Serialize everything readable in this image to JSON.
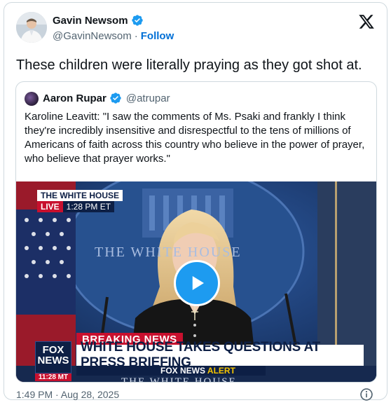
{
  "tweet": {
    "author_name": "Gavin Newsom",
    "author_handle": "@GavinNewsom",
    "separator": "·",
    "follow_label": "Follow",
    "text": "These children were literally praying as they got shot at.",
    "timestamp": "1:49 PM · Aug 28, 2025"
  },
  "quoted_tweet": {
    "author_name": "Aaron Rupar",
    "author_handle": "@atrupar",
    "text": "Karoline Leavitt: \"I saw the comments of Ms. Psaki and frankly I think they're incredibly insensitive and disrespectful to the tens of millions of Americans of faith across this country who believe in the power of prayer, who believe that prayer works.\""
  },
  "video": {
    "top_caption": "THE WHITE HOUSE",
    "live_label": "LIVE",
    "live_time": "1:28 PM ET",
    "seal_text": "THE WHITE HOUSE",
    "breaking_label": "BREAKING NEWS",
    "headline": "WHITE HOUSE TAKES QUESTIONS AT PRESS BRIEFING",
    "alert_brand": "FOX NEWS",
    "alert_word": "ALERT",
    "logo_line1": "FOX",
    "logo_line2": "NEWS",
    "logo_time": "11:28 MT",
    "bottom_text": "THE WHITE HOUSE"
  },
  "icons": {
    "verified": "verified-badge-icon",
    "x_logo": "x-logo-icon",
    "play": "play-icon",
    "info": "info-icon"
  },
  "colors": {
    "link": "#006fd6",
    "verified": "#1d9bf0",
    "play_button": "#1d9bf0",
    "fox_red": "#c8102e",
    "fox_navy": "#0d1f45"
  }
}
